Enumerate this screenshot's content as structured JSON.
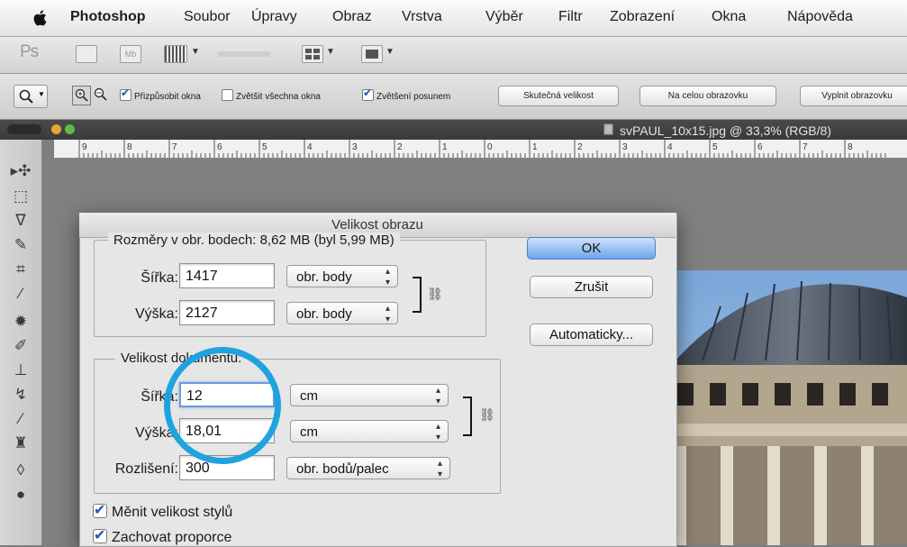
{
  "menubar": {
    "app_name": "Photoshop",
    "items": [
      "Soubor",
      "Úpravy",
      "Obraz",
      "Vrstva",
      "Výběr",
      "Filtr",
      "Zobrazení",
      "Okna",
      "Nápověda"
    ]
  },
  "appbar": {
    "logo": "Ps",
    "mb_label": "Mb"
  },
  "options": {
    "chk_fit_label": "Přizpůsobit okna",
    "chk_zoom_all_label": "Zvětšit všechna okna",
    "chk_scrubby_label": "Zvětšení posunem",
    "btn_actual": "Skutečná velikost",
    "btn_fit_screen": "Na celou obrazovku",
    "btn_fill_screen": "Vyplnit obrazovku"
  },
  "document": {
    "title": "svPAUL_10x15.jpg @ 33,3% (RGB/8)"
  },
  "ruler": {
    "labels": [
      "9",
      "8",
      "7",
      "6",
      "5",
      "4",
      "3",
      "2",
      "1",
      "0",
      "1",
      "2",
      "3",
      "4",
      "5",
      "6",
      "7",
      "8"
    ]
  },
  "dialog": {
    "title": "Velikost obrazu",
    "pixel_group_label": "Rozměry v obr. bodech:  8,62 MB (byl 5,99 MB)",
    "doc_group_label": "Velikost dokumentu:",
    "width_label": "Šířka:",
    "height_label": "Výška:",
    "resolution_label": "Rozlišení:",
    "px_width": "1417",
    "px_height": "2127",
    "px_unit": "obr. body",
    "doc_width": "12",
    "doc_height": "18,01",
    "doc_unit": "cm",
    "resolution": "300",
    "resolution_unit": "obr. bodů/palec",
    "ok": "OK",
    "cancel": "Zrušit",
    "auto": "Automaticky...",
    "chk_scale_styles": "Měnit velikost stylů",
    "chk_constrain": "Zachovat proporce"
  },
  "colors": {
    "highlight_circle": "#1fa3df",
    "ok_button": "#6fa3ea"
  }
}
